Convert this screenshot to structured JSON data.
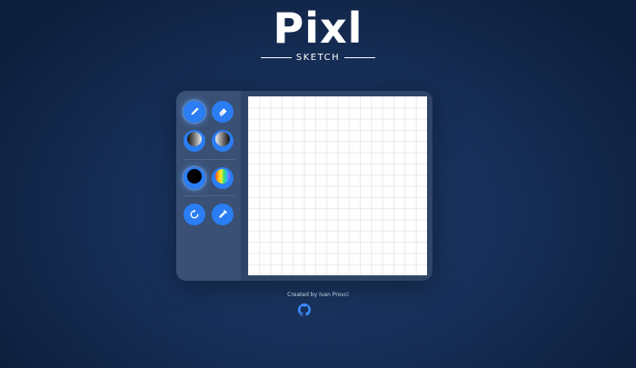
{
  "header": {
    "title": "Pixl",
    "subtitle": "SKETCH"
  },
  "toolbar": {
    "tools": [
      {
        "name": "pencil",
        "icon": "pencil-icon",
        "active": true
      },
      {
        "name": "eraser",
        "icon": "eraser-icon",
        "active": false
      },
      {
        "name": "shade",
        "icon": "shade-icon",
        "active": false
      },
      {
        "name": "lighten",
        "icon": "lighten-icon",
        "active": false
      },
      {
        "name": "black-color",
        "icon": "black-circle-icon",
        "active": true
      },
      {
        "name": "rainbow",
        "icon": "rainbow-icon",
        "active": false
      },
      {
        "name": "reset",
        "icon": "refresh-icon",
        "active": false
      },
      {
        "name": "color-picker",
        "icon": "eyedropper-icon",
        "active": false
      }
    ]
  },
  "canvas": {
    "grid_size": 16,
    "grid_line_color": "#e7e9ee"
  },
  "footer": {
    "credit": "Created by Ivan Provci",
    "github_icon": "github-icon"
  },
  "colors": {
    "accent": "#2a7df3",
    "panel": "#2f4466",
    "toolbar": "#3a5074"
  }
}
